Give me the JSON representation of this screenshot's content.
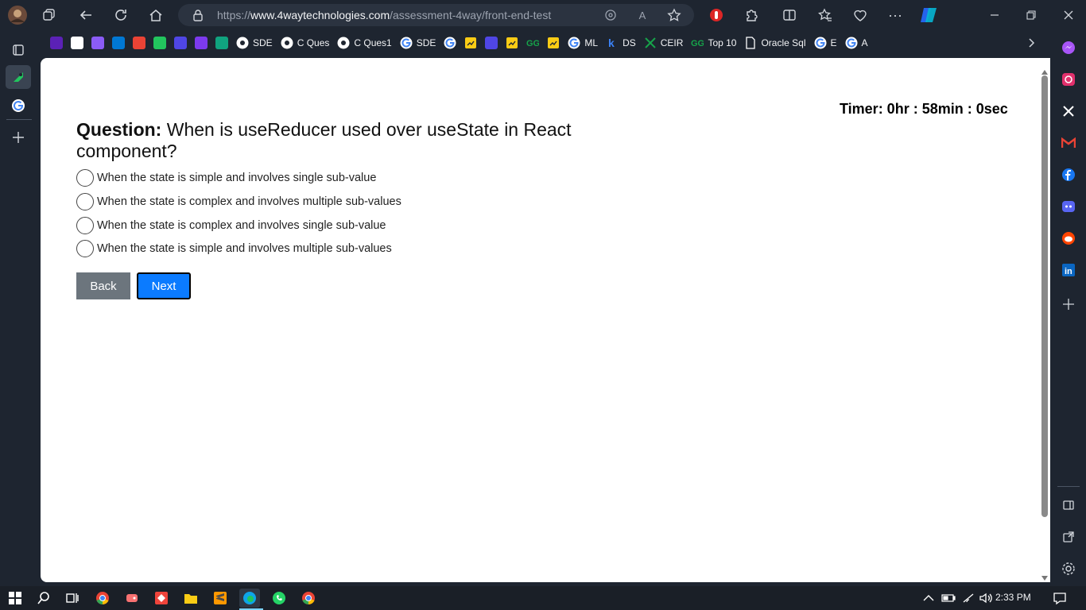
{
  "browser": {
    "url_prefix": "https://",
    "url_host": "www.4waytechnologies.com",
    "url_path": "/assessment-4way/front-end-test",
    "bookmarks": [
      {
        "label": "",
        "icon": "purple-app-icon",
        "color": "#5b21b6"
      },
      {
        "label": "",
        "icon": "flame-icon",
        "color": "#ffffff"
      },
      {
        "label": "",
        "icon": "to-icon",
        "color": "#8b5cf6"
      },
      {
        "label": "",
        "icon": "outlook-icon",
        "color": "#0078d4"
      },
      {
        "label": "",
        "icon": "gmail-icon",
        "color": "#ea4335"
      },
      {
        "label": "",
        "icon": "sheets-icon",
        "color": "#22c55e"
      },
      {
        "label": "",
        "icon": "stack-icon",
        "color": "#4f46e5"
      },
      {
        "label": "",
        "icon": "y-icon",
        "color": "#7c3aed"
      },
      {
        "label": "",
        "icon": "chatgpt-icon",
        "color": "#10a37f"
      },
      {
        "label": "SDE",
        "icon": "github-icon",
        "color": "#ffffff"
      },
      {
        "label": "C Ques",
        "icon": "github-icon",
        "color": "#ffffff"
      },
      {
        "label": "C Ques1",
        "icon": "github-icon",
        "color": "#ffffff"
      },
      {
        "label": "SDE",
        "icon": "google-icon",
        "color": "#ffffff"
      },
      {
        "label": "",
        "icon": "google-icon",
        "color": "#ffffff"
      },
      {
        "label": "",
        "icon": "chart-icon",
        "color": "#facc15"
      },
      {
        "label": "",
        "icon": "circle-icon",
        "color": "#4f46e5"
      },
      {
        "label": "",
        "icon": "chart-icon",
        "color": "#facc15"
      },
      {
        "label": "",
        "icon": "gfg-icon",
        "color": "#16a34a"
      },
      {
        "label": "",
        "icon": "chart-icon",
        "color": "#facc15"
      },
      {
        "label": "ML",
        "icon": "google-icon",
        "color": "#ffffff"
      },
      {
        "label": "DS",
        "icon": "k-icon",
        "color": "#3b82f6"
      },
      {
        "label": "CEIR",
        "icon": "x-icon",
        "color": "#16a34a"
      },
      {
        "label": "Top 10",
        "icon": "gfg-icon",
        "color": "#16a34a"
      },
      {
        "label": "Oracle Sql",
        "icon": "file-icon",
        "color": "#ffffff"
      },
      {
        "label": "E",
        "icon": "google-icon",
        "color": "#ffffff"
      },
      {
        "label": "A",
        "icon": "google-icon",
        "color": "#ffffff"
      }
    ]
  },
  "quiz": {
    "timer": "Timer: 0hr : 58min : 0sec",
    "question_label": "Question:",
    "question_text": "When is useReducer used over useState in React component?",
    "options": [
      "When the state is simple and involves single sub-value",
      "When the state is complex and involves multiple sub-values",
      "When the state is complex and involves single sub-value",
      "When the state is simple and involves multiple sub-values"
    ],
    "back_label": "Back",
    "next_label": "Next"
  },
  "taskbar": {
    "clock": "2:33 PM"
  }
}
